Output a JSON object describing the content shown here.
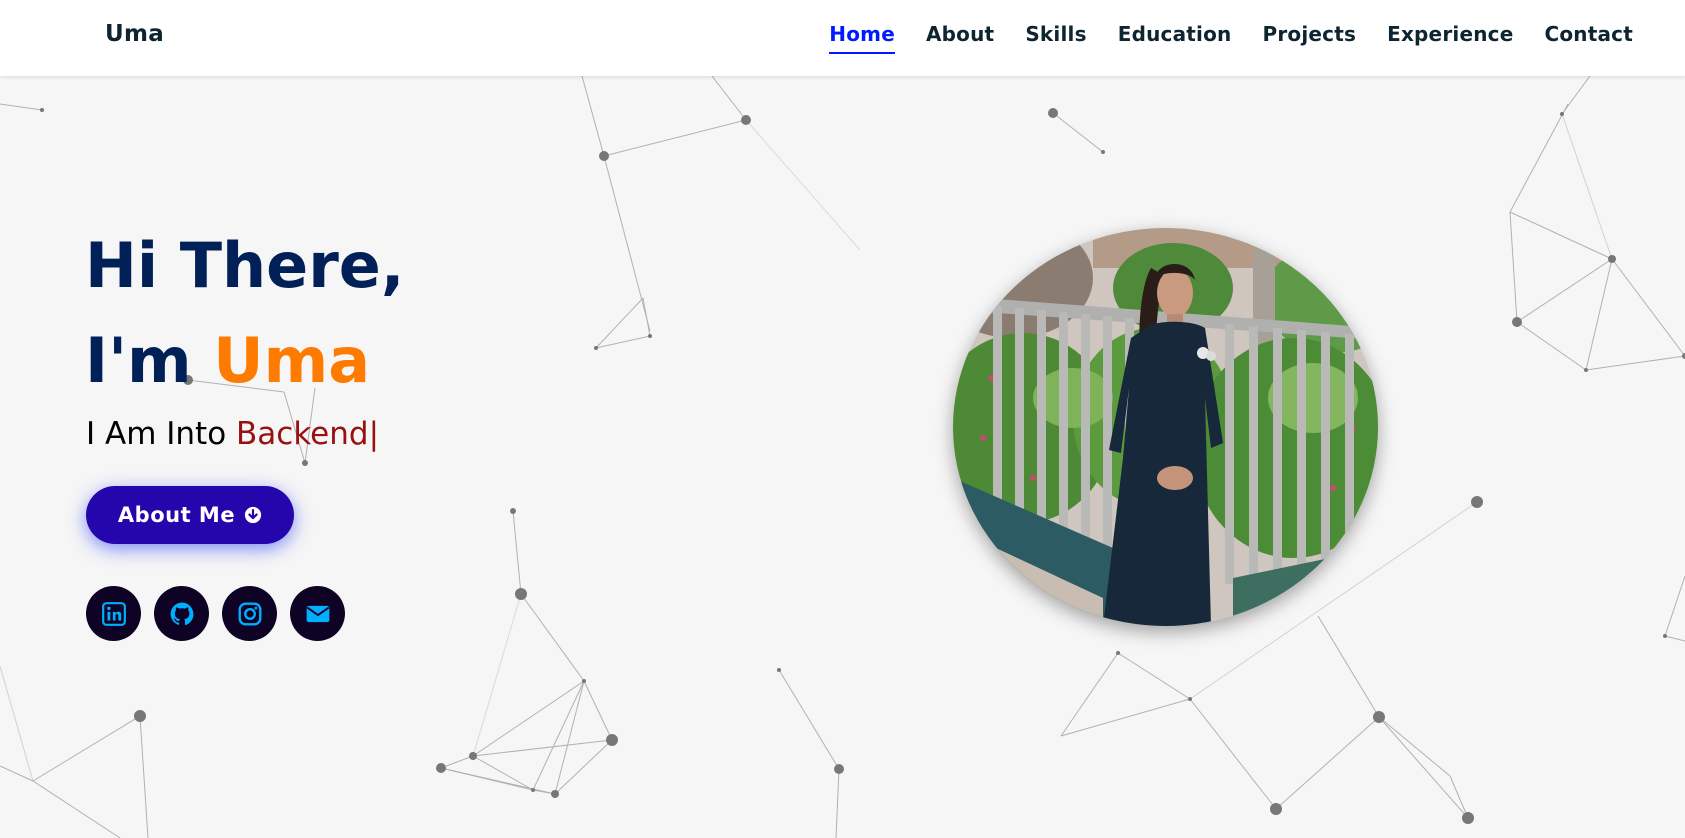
{
  "navbar": {
    "logo": "Uma",
    "links": [
      {
        "label": "Home",
        "active": true
      },
      {
        "label": "About"
      },
      {
        "label": "Skills"
      },
      {
        "label": "Education"
      },
      {
        "label": "Projects"
      },
      {
        "label": "Experience"
      },
      {
        "label": "Contact"
      }
    ]
  },
  "hero": {
    "greeting": "Hi There,",
    "intro_prefix": "I'm",
    "name": "Uma",
    "typed_prefix": "I Am Into",
    "typed_word": "Backend|",
    "button_label": "About Me",
    "socials": [
      {
        "icon": "linkedin-icon"
      },
      {
        "icon": "github-icon"
      },
      {
        "icon": "instagram-icon"
      },
      {
        "icon": "envelope-icon"
      }
    ]
  },
  "colors": {
    "nav_text": "#0e2431",
    "nav_active": "#011aff",
    "heading": "#002057",
    "name_accent": "#ff7b00",
    "typed_word": "#991010",
    "button_bg": "#2506ad",
    "social_bg": "#0e0325",
    "social_icon": "#00aeff",
    "page_bg": "#f6f6f6"
  }
}
